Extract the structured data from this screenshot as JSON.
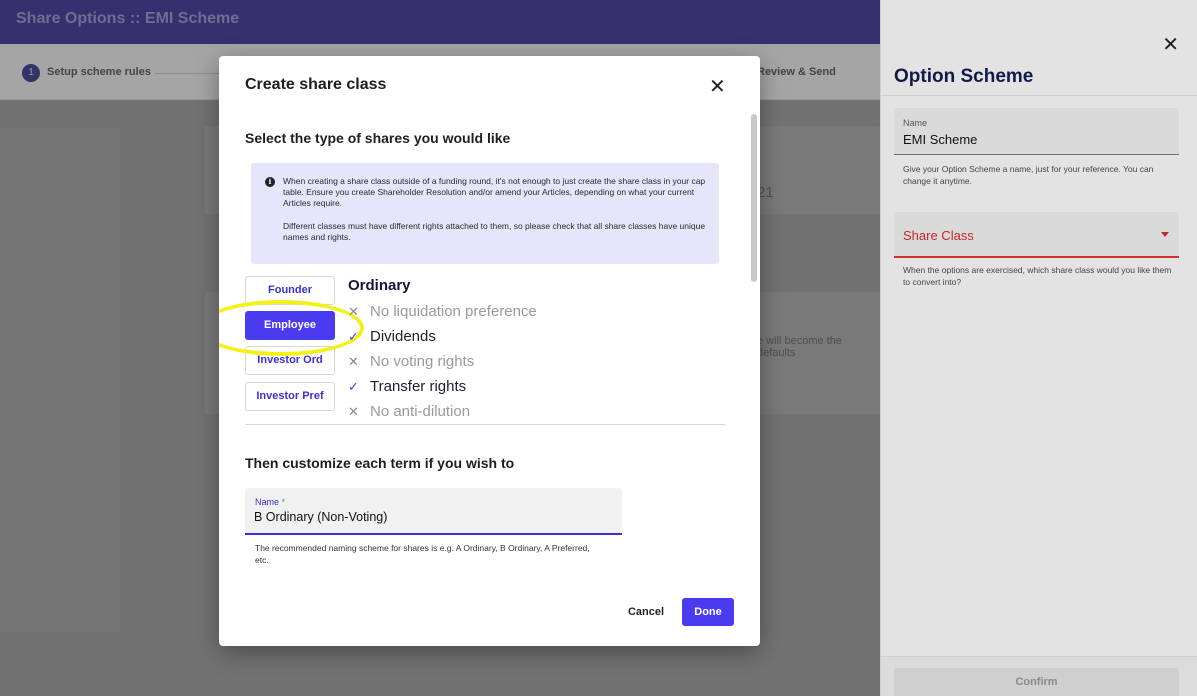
{
  "app": {
    "title": "Share Options :: EMI Scheme",
    "steps": [
      {
        "number": "1",
        "label": "Setup scheme rules"
      },
      {
        "label": "Review & Send"
      }
    ],
    "background_fragments": [
      "21",
      "e will become the defaults"
    ]
  },
  "drawer": {
    "title": "Option Scheme",
    "name_field": {
      "label": "Name",
      "value": "EMI Scheme",
      "helper": "Give your Option Scheme a name, just for your reference. You can change it anytime."
    },
    "share_class_field": {
      "label": "Share Class",
      "helper": "When the options are exercised, which share class would you like them to convert into?"
    },
    "confirm_label": "Confirm"
  },
  "modal": {
    "title": "Create share class",
    "section1_heading": "Select the type of shares you would like",
    "info": {
      "icon": "info-icon",
      "paragraph1": "When creating a share class outside of a funding round, it's not enough to just create the share class in your cap table. Ensure you create Shareholder Resolution and/or amend your Articles, depending on what your current Articles require.",
      "paragraph2": "Different classes must have different rights attached to them, so please check that all share classes have unique names and rights."
    },
    "share_types": [
      "Founder",
      "Employee",
      "Investor Ord",
      "Investor Pref"
    ],
    "selected_type": "Employee",
    "rights_title": "Ordinary",
    "rights": [
      {
        "label": "No liquidation preference",
        "enabled": false
      },
      {
        "label": "Dividends",
        "enabled": true
      },
      {
        "label": "No voting rights",
        "enabled": false
      },
      {
        "label": "Transfer rights",
        "enabled": true
      },
      {
        "label": "No anti-dilution",
        "enabled": false
      }
    ],
    "section2_heading": "Then customize each term if you wish to",
    "name_field": {
      "label": "Name",
      "required_mark": "*",
      "value": "B Ordinary (Non-Voting)",
      "helper": "The recommended naming scheme for shares is e.g. A Ordinary, B Ordinary, A Preferred, etc."
    },
    "cancel_label": "Cancel",
    "done_label": "Done"
  },
  "colors": {
    "accent": "#4b3bf0",
    "topbar": "#1f1687",
    "error": "#d32f2f",
    "highlight": "#f4f01c"
  }
}
